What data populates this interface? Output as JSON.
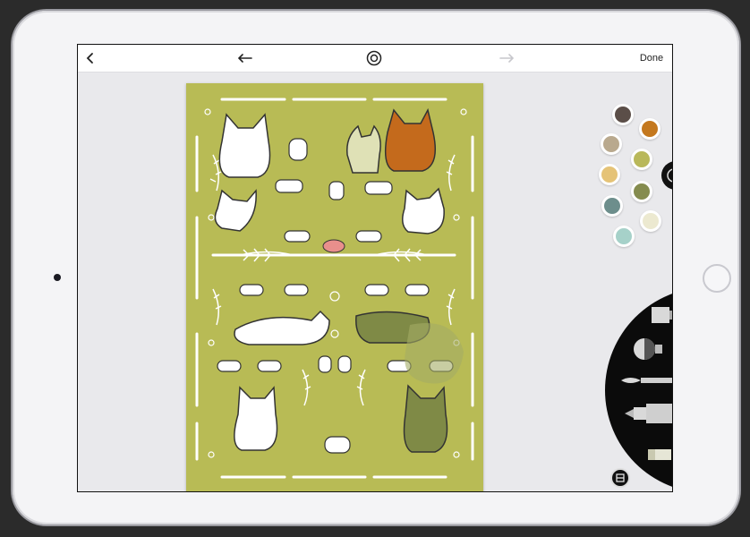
{
  "toolbar": {
    "back_icon": "chevron-left-icon",
    "undo_icon": "undo-arrow-icon",
    "center_icon": "circle-target-icon",
    "redo_icon": "redo-arrow-icon",
    "done_label": "Done"
  },
  "canvas": {
    "background_color": "#b8bb55",
    "content": "cat-pattern-artwork"
  },
  "palette": {
    "colors": [
      "#5b4e48",
      "#c4781e",
      "#b9a98e",
      "#b9b85a",
      "#e5c377",
      "#858c4f",
      "#6d8e8c",
      "#ece9d0",
      "#a6d1c9"
    ]
  },
  "tools": {
    "items": [
      "marker-tool",
      "ink-pot-tool",
      "brush-tool",
      "pen-tool",
      "eraser-tool"
    ],
    "layers_icon": "layers-icon"
  }
}
